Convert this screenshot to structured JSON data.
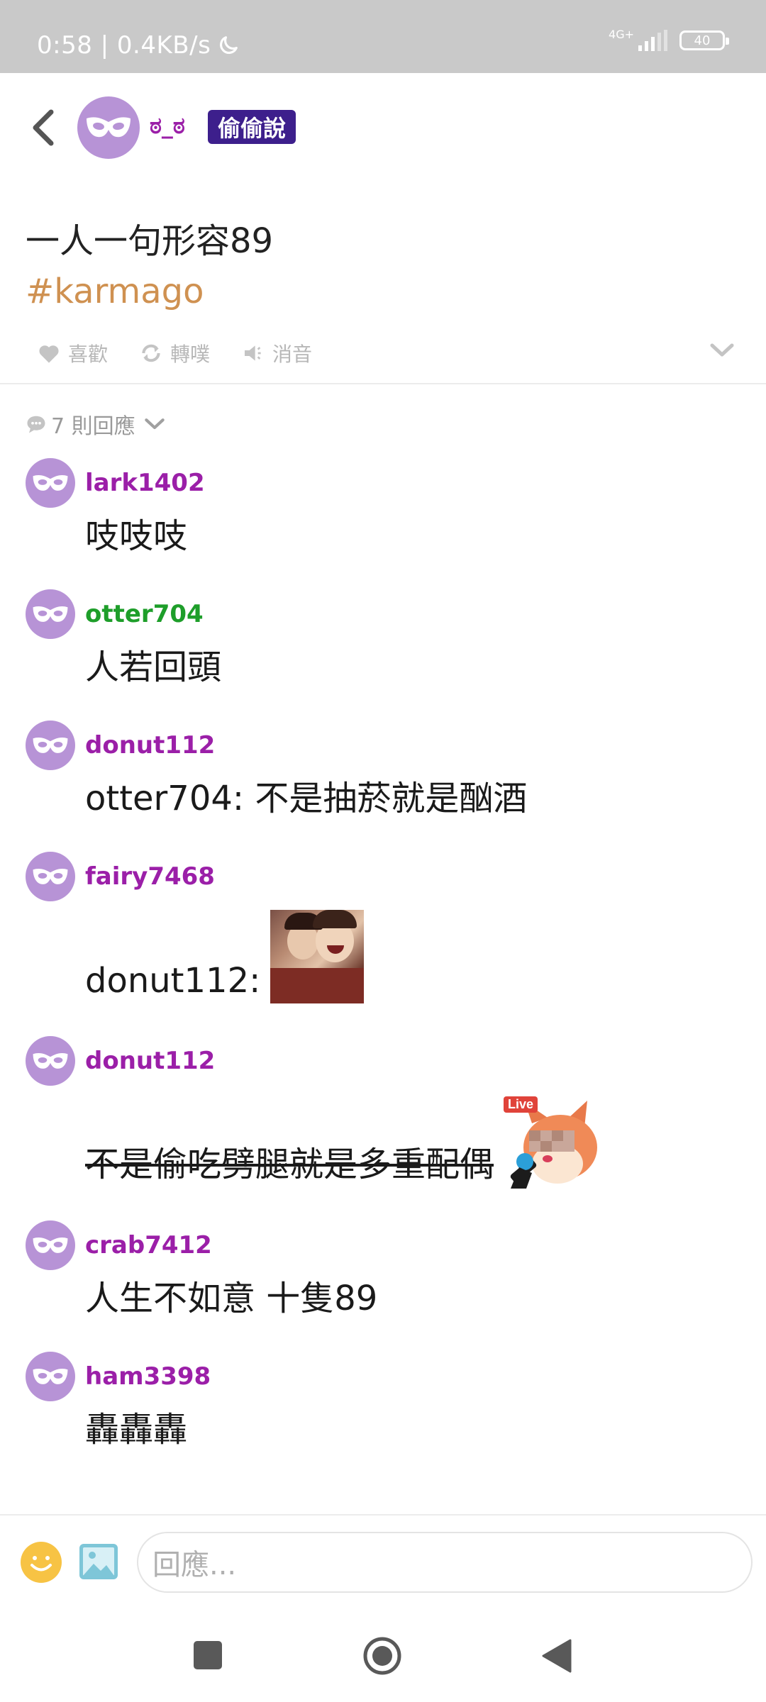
{
  "status_bar": {
    "time_speed": "0:58 | 0.4KB/s",
    "network": "4G+",
    "battery": "40"
  },
  "header": {
    "username": "ಠ_ಠ",
    "badge": "偷偷說"
  },
  "post": {
    "content": "一人一句形容89",
    "tag": "#karmago",
    "actions": {
      "like": "喜歡",
      "replurk": "轉噗",
      "mute": "消音"
    }
  },
  "replies_toggle": "7 則回應",
  "comments": [
    {
      "name": "lark1402",
      "name_color": "#9b1fa8",
      "text": "吱吱吱"
    },
    {
      "name": "otter704",
      "name_color": "#1e9e2a",
      "text": "人若回頭"
    },
    {
      "name": "donut112",
      "name_color": "#9b1fa8",
      "text": "otter704: 不是抽菸就是酗酒"
    },
    {
      "name": "fairy7468",
      "name_color": "#9b1fa8",
      "text": "donut112:"
    },
    {
      "name": "donut112",
      "name_color": "#9b1fa8",
      "text": "不是偷吃劈腿就是多重配偶"
    },
    {
      "name": "crab7412",
      "name_color": "#9b1fa8",
      "text": "人生不如意 十隻89"
    },
    {
      "name": "ham3398",
      "name_color": "#9b1fa8",
      "text": "轟轟轟"
    }
  ],
  "stickers": {
    "live_label": "Live"
  },
  "composer": {
    "placeholder": "回應..."
  },
  "icons": {
    "back": "back-icon",
    "mask": "mask-icon",
    "heart": "heart-icon",
    "repeat": "repeat-icon",
    "mute": "speaker-icon",
    "chevron": "chevron-down-icon",
    "comment": "comment-icon",
    "emoji": "emoji-icon",
    "image": "image-icon"
  },
  "colors": {
    "avatar": "#b793d6",
    "badge_bg": "#3d1f8c",
    "tag": "#cf9151",
    "username_purple": "#9b1fa8",
    "username_green": "#1e9e2a"
  }
}
